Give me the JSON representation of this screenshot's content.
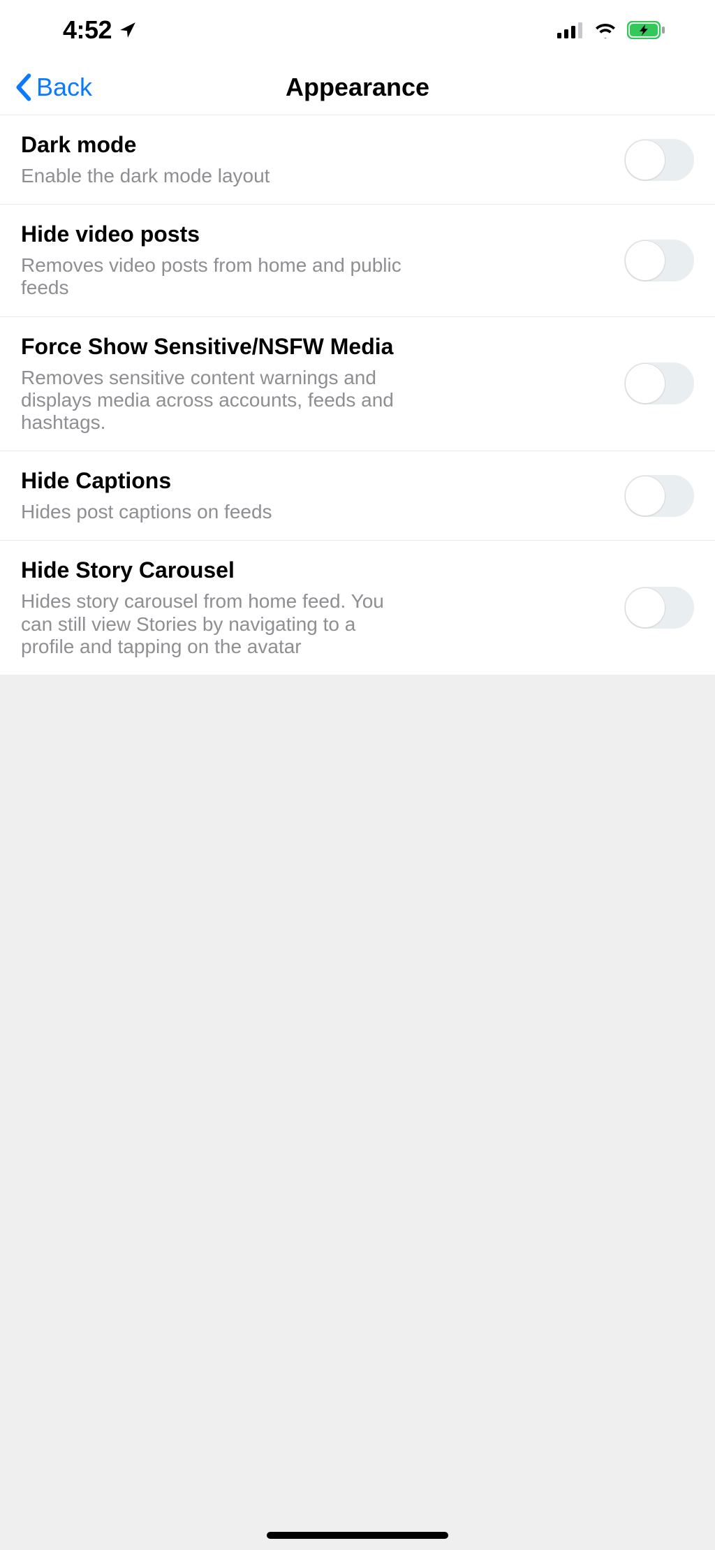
{
  "status": {
    "time": "4:52",
    "location_icon": "location-arrow",
    "cellular_bars": 4,
    "wifi": true,
    "battery_charging": true
  },
  "nav": {
    "back_label": "Back",
    "title": "Appearance"
  },
  "settings": [
    {
      "id": "dark-mode",
      "title": "Dark mode",
      "desc": "Enable the dark mode layout",
      "value": false
    },
    {
      "id": "hide-video-posts",
      "title": "Hide video posts",
      "desc": "Removes video posts from home and public feeds",
      "value": false
    },
    {
      "id": "force-show-sensitive",
      "title": "Force Show Sensitive/NSFW Media",
      "desc": "Removes sensitive content warnings and displays media across accounts, feeds and hashtags.",
      "value": false
    },
    {
      "id": "hide-captions",
      "title": "Hide Captions",
      "desc": "Hides post captions on feeds",
      "value": false
    },
    {
      "id": "hide-story-carousel",
      "title": "Hide Story Carousel",
      "desc": "Hides story carousel from home feed. You can still view Stories by navigating to a profile and tapping on the avatar",
      "value": false
    }
  ]
}
